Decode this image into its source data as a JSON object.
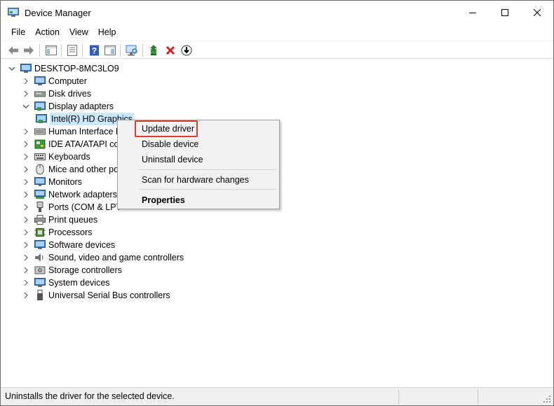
{
  "window": {
    "title": "Device Manager"
  },
  "menu": [
    "File",
    "Action",
    "View",
    "Help"
  ],
  "toolbar": {
    "buttons": [
      "back-arrow-icon",
      "forward-arrow-icon",
      "show-hide-console-tree-icon",
      "properties-sheet-icon",
      "help-icon",
      "action-pane-icon",
      "scan-hardware-icon",
      "update-driver-icon",
      "uninstall-device-icon",
      "download-driver-icon"
    ]
  },
  "tree": {
    "root": "DESKTOP-8MC3LO9",
    "items": [
      {
        "label": "Computer",
        "icon": "computer-icon",
        "expanded": false
      },
      {
        "label": "Disk drives",
        "icon": "disk-drive-icon",
        "expanded": false
      },
      {
        "label": "Display adapters",
        "icon": "display-adapter-icon",
        "expanded": true
      },
      {
        "label": "Intel(R) HD Graphics",
        "icon": "display-adapter-icon",
        "child": true,
        "selected": true
      },
      {
        "label": "Human Interface D",
        "icon": "hid-icon",
        "expanded": false
      },
      {
        "label": "IDE ATA/ATAPI cor",
        "icon": "ide-controller-icon",
        "expanded": false
      },
      {
        "label": "Keyboards",
        "icon": "keyboard-icon",
        "expanded": false
      },
      {
        "label": "Mice and other po",
        "icon": "mouse-icon",
        "expanded": false
      },
      {
        "label": "Monitors",
        "icon": "monitor-icon",
        "expanded": false
      },
      {
        "label": "Network adapters",
        "icon": "network-adapter-icon",
        "expanded": false
      },
      {
        "label": "Ports (COM & LPT",
        "icon": "port-icon",
        "expanded": false
      },
      {
        "label": "Print queues",
        "icon": "printer-icon",
        "expanded": false
      },
      {
        "label": "Processors",
        "icon": "processor-icon",
        "expanded": false
      },
      {
        "label": "Software devices",
        "icon": "software-device-icon",
        "expanded": false
      },
      {
        "label": "Sound, video and game controllers",
        "icon": "sound-icon",
        "expanded": false
      },
      {
        "label": "Storage controllers",
        "icon": "storage-controller-icon",
        "expanded": false
      },
      {
        "label": "System devices",
        "icon": "system-device-icon",
        "expanded": false
      },
      {
        "label": "Universal Serial Bus controllers",
        "icon": "usb-icon",
        "expanded": false
      }
    ]
  },
  "context_menu": {
    "items": [
      "Update driver",
      "Disable device",
      "Uninstall device",
      "Scan for hardware changes",
      "Properties"
    ],
    "highlighted": "Update driver",
    "highlight_color": "#e03c2c"
  },
  "status": {
    "text": "Uninstalls the driver for the selected device."
  },
  "colors": {
    "selection": "#cce8ff",
    "menu_bg": "#f2f2f2"
  }
}
